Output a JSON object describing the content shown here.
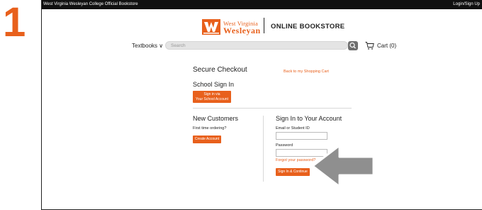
{
  "step_number": "1",
  "topbar": {
    "store_name": "West Virginia Wesleyan College Official Bookstore",
    "login_link": "Login/Sign Up"
  },
  "header": {
    "logo_line1": "West Virginia",
    "logo_line2": "Wesleyan",
    "bookstore_title": "ONLINE BOOKSTORE",
    "brand_color": "#e8601c"
  },
  "nav": {
    "textbooks_label": "Textbooks ∨",
    "search_placeholder": "Search",
    "cart_label": "Cart (0)"
  },
  "checkout": {
    "title": "Secure Checkout",
    "back_link": "Back to my Shopping Cart",
    "school_signin_title": "School Sign In",
    "school_btn_line1": "Sign in via",
    "school_btn_line2": "Your School Account",
    "new_customers_title": "New Customers",
    "first_time": "First time ordering?",
    "create_account": "Create Account",
    "signin_title": "Sign In to Your Account",
    "email_label": "Email or Student ID",
    "password_label": "Password",
    "forgot_password": "Forgot your password?",
    "signin_button": "Sign In & Continue"
  }
}
